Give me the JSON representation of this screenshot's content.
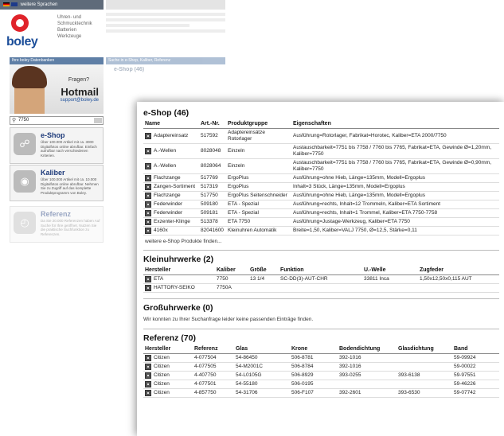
{
  "background": {
    "topbar_text": "weitere Sprachen",
    "brand": "boley",
    "tagline": [
      "Uhren- und",
      "Schmucktechnik",
      "Batterien",
      "Werkzeuge"
    ],
    "leftbar_heading": "Ihre boley Datenbanken",
    "promo_question": "Fragen?",
    "promo_hotmail": "Hotmail",
    "promo_email": "support@boley.de",
    "search_value": "7750",
    "search_strip": "Suche in e-Shop, Kaliber, Referenz",
    "faded_heading": "e-Shop (46)",
    "cards": [
      {
        "title": "e-Shop",
        "desc": "Über 100.000 Artikel mit ca. 3000 Digitalfotos online abrufbar. Einfach aufrufbar nach verschiedenen Kriterien."
      },
      {
        "title": "Kaliber",
        "desc": "Über 100.000 Artikel mit ca. 10.000 Digitalfotos online abrufbar. Nehmen Sie zu Zugriff auf das komplette Produktprogramm von Boley."
      },
      {
        "title": "Referenz",
        "desc": "Da Sie 20.000 Referenzen haben Auf Suche für Ihre geöffnet. Nutzen Sie die praktische Suchfunktion zu Referenzen."
      }
    ]
  },
  "eshop": {
    "title": "e-Shop (46)",
    "headers": [
      "Name",
      "Art.-Nr.",
      "Produktgruppe",
      "Eigenschaften"
    ],
    "rows": [
      [
        "Adaptereinsatz",
        "517592",
        "Adaptereinsätze Rotorlager",
        "Ausführung=Rotorlager, Fabrikat=Horotec, Kaliber=ETA 2000/7750"
      ],
      [
        "A.-Wellen",
        "8028048",
        "Einzeln",
        "Austauschbarkeit=7751 bis 7758 / 7760 bis 7765, Fabrikat=ETA, Gewinde Ø=1,20mm, Kaliber=7750"
      ],
      [
        "A.-Wellen",
        "8028064",
        "Einzeln",
        "Austauschbarkeit=7751 bis 7758 / 7760 bis 7765, Fabrikat=ETA, Gewinde Ø=0,90mm, Kaliber=7750"
      ],
      [
        "Flachzange",
        "517769",
        "ErgoPlus",
        "Ausführung=ohne Hieb, Länge=135mm, Modell=Ergoplus"
      ],
      [
        "Zangen-Sortiment",
        "517319",
        "ErgoPlus",
        "Inhalt=3 Stück, Länge=135mm, Modell=Ergoplus"
      ],
      [
        "Flachzange",
        "517750",
        "ErgoPlus Seitenschneider",
        "Ausführung=ohne Hieb, Länge=135mm, Modell=Ergoplus"
      ],
      [
        "Federwinder",
        "509180",
        "ETA - Spezial",
        "Ausführung=rechts, Inhalt=12 Trommeln, Kaliber=ETA Sortiment"
      ],
      [
        "Federwinder",
        "509181",
        "ETA - Spezial",
        "Ausführung=rechts, Inhalt=1 Trommel, Kaliber=ETA 7750-7758"
      ],
      [
        "Exzenter-Klinge",
        "513378",
        "ETA 7750",
        "Ausführung=Justage-Werkzeug, Kaliber=ETA 7750"
      ],
      [
        "4160x",
        "82041600",
        "Kleinuhren Automatik",
        "Breite=1,50, Kaliber=VALJ 7750, Ø=12,5, Stärke=0,11"
      ]
    ],
    "more_link": "weitere e-Shop Produkte finden..."
  },
  "kleinuhrwerke": {
    "title": "Kleinuhrwerke (2)",
    "headers": [
      "Hersteller",
      "Kaliber",
      "Größe",
      "Funktion",
      "U.-Welle",
      "Zugfeder"
    ],
    "rows": [
      [
        "ETA",
        "7750",
        "13 1/4",
        "SC-DD(3)-AUT-CHR",
        "33811 Inca",
        "1,50x12,50x0,115 AUT"
      ],
      [
        "HATTORY-SEIKO",
        "7750A",
        "",
        "",
        "",
        ""
      ]
    ]
  },
  "grossuhrwerke": {
    "title": "Großuhrwerke (0)",
    "note": "Wir konnten zu Ihrer Suchanfrage leider keine passenden Einträge finden."
  },
  "referenz": {
    "title": "Referenz (70)",
    "headers": [
      "Hersteller",
      "Referenz",
      "Glas",
      "Krone",
      "Bodendichtung",
      "Glasdichtung",
      "Band"
    ],
    "rows": [
      [
        "Citizen",
        "4-077504",
        "54-86450",
        "506-8781",
        "392-1016",
        "",
        "59-09924"
      ],
      [
        "Citizen",
        "4-077505",
        "54-M2001C",
        "506-8784",
        "392-1016",
        "",
        "59-00022"
      ],
      [
        "Citizen",
        "4-407750",
        "54-L0105G",
        "506-8929",
        "393-0255",
        "393-6138",
        "59-97551"
      ],
      [
        "Citizen",
        "4-077501",
        "54-55180",
        "506-0195",
        "",
        "",
        "59-46226"
      ],
      [
        "Citizen",
        "4-857750",
        "54-31706",
        "506-F107",
        "392-2601",
        "393-6530",
        "59-07742"
      ]
    ]
  }
}
